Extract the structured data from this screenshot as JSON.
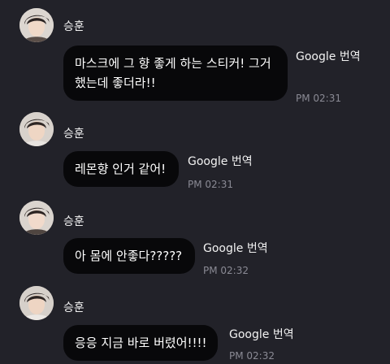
{
  "messages": [
    {
      "sender": "승훈",
      "text": "마스크에 그 향 좋게 하는 스티커! 그거 했는데 좋더라!!",
      "translate_label": "Google 번역",
      "time": "PM 02:31"
    },
    {
      "sender": "승훈",
      "text": "레몬향 인거 같어!",
      "translate_label": "Google 번역",
      "time": "PM 02:31"
    },
    {
      "sender": "승훈",
      "text": "아 몸에 안좋다?????",
      "translate_label": "Google 번역",
      "time": "PM 02:32"
    },
    {
      "sender": "승훈",
      "text": "응응 지금 바로 버렸어!!!!",
      "translate_label": "Google 번역",
      "time": "PM 02:32"
    }
  ],
  "colors": {
    "background": "#222229",
    "bubble": "#08080a",
    "timestamp": "#8a8a94"
  }
}
